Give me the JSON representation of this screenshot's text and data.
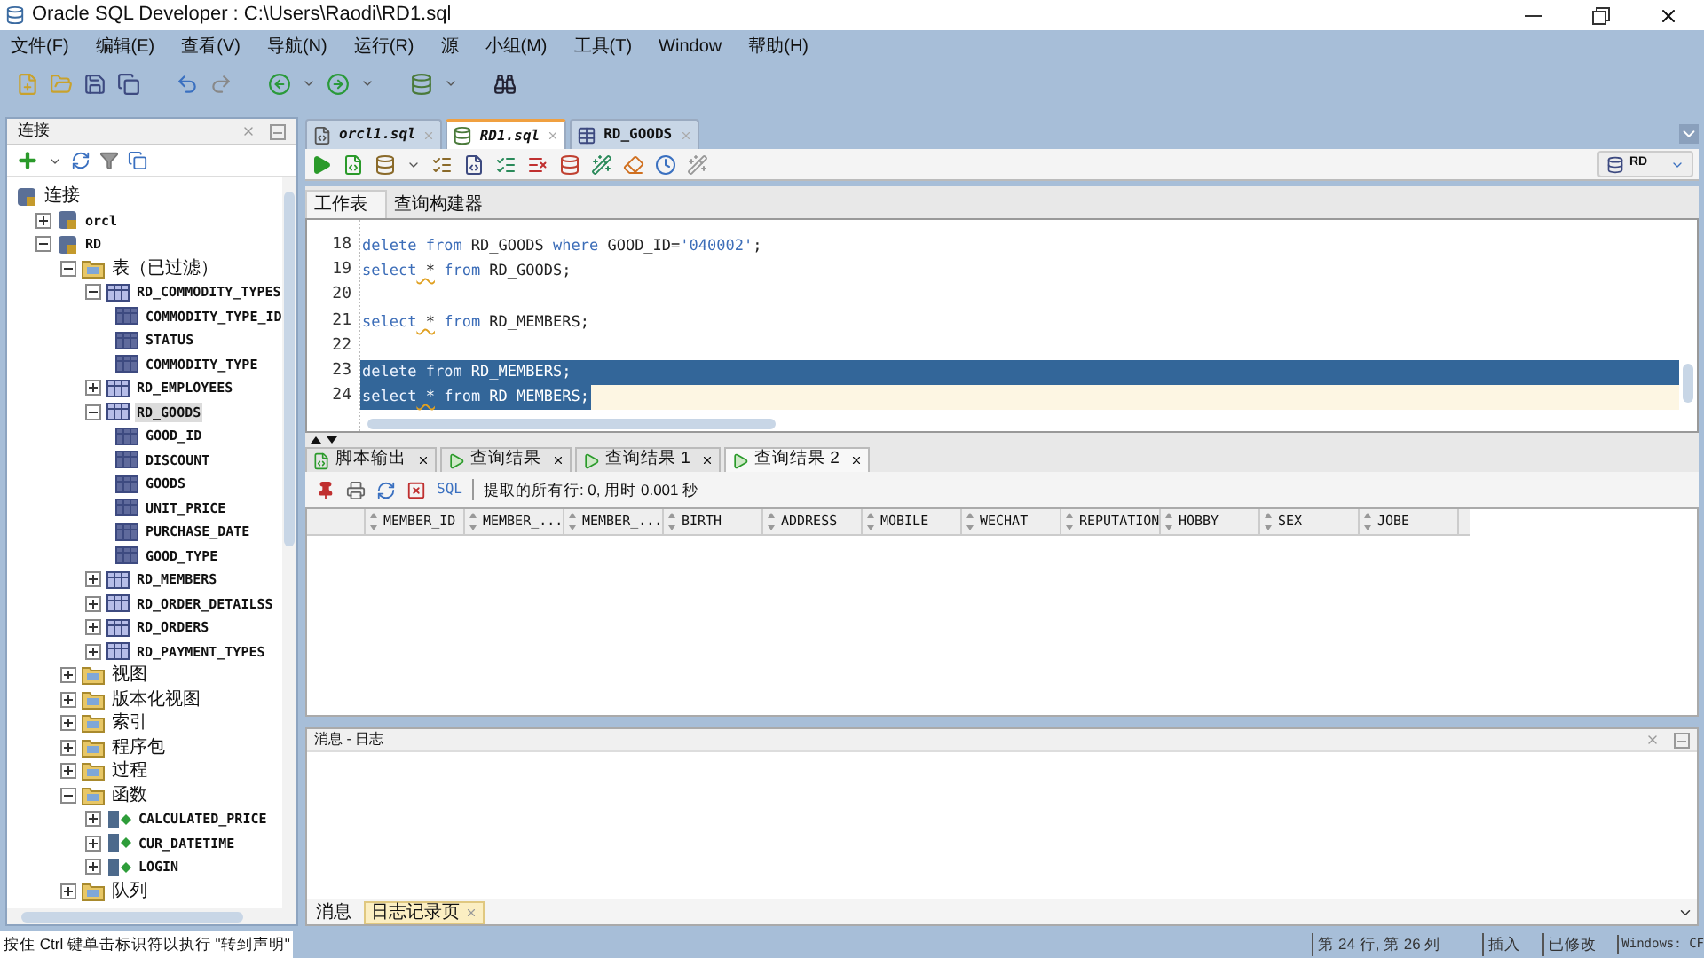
{
  "window": {
    "title": "Oracle SQL Developer : C:\\Users\\Raodi\\RD1.sql"
  },
  "menu": [
    "文件(F)",
    "编辑(E)",
    "查看(V)",
    "导航(N)",
    "运行(R)",
    "源",
    "小组(M)",
    "工具(T)",
    "Window",
    "帮助(H)"
  ],
  "connections_panel": {
    "title": "连接",
    "tree": [
      {
        "label": "连接",
        "kind": "root",
        "selected": false,
        "children": [
          {
            "label": "orcl",
            "kind": "connection",
            "expanded": false,
            "selected": false
          },
          {
            "label": "RD",
            "kind": "connection",
            "expanded": true,
            "selected": false,
            "children": [
              {
                "label": "表（已过滤）",
                "kind": "folder",
                "expanded": true,
                "selected": false,
                "children": [
                  {
                    "label": "RD_COMMODITY_TYPES",
                    "kind": "table",
                    "expanded": true,
                    "selected": false,
                    "children": [
                      {
                        "label": "COMMODITY_TYPE_ID",
                        "kind": "column",
                        "selected": false
                      },
                      {
                        "label": "STATUS",
                        "kind": "column",
                        "selected": false
                      },
                      {
                        "label": "COMMODITY_TYPE",
                        "kind": "column",
                        "selected": false
                      }
                    ]
                  },
                  {
                    "label": "RD_EMPLOYEES",
                    "kind": "table",
                    "expanded": false,
                    "selected": false
                  },
                  {
                    "label": "RD_GOODS",
                    "kind": "table",
                    "expanded": true,
                    "selected": true,
                    "children": [
                      {
                        "label": "GOOD_ID",
                        "kind": "column",
                        "selected": false
                      },
                      {
                        "label": "DISCOUNT",
                        "kind": "column",
                        "selected": false
                      },
                      {
                        "label": "GOODS",
                        "kind": "column",
                        "selected": false
                      },
                      {
                        "label": "UNIT_PRICE",
                        "kind": "column",
                        "selected": false
                      },
                      {
                        "label": "PURCHASE_DATE",
                        "kind": "column",
                        "selected": false
                      },
                      {
                        "label": "GOOD_TYPE",
                        "kind": "column",
                        "selected": false
                      }
                    ]
                  },
                  {
                    "label": "RD_MEMBERS",
                    "kind": "table",
                    "expanded": false,
                    "selected": false
                  },
                  {
                    "label": "RD_ORDER_DETAILSS",
                    "kind": "table",
                    "expanded": false,
                    "selected": false
                  },
                  {
                    "label": "RD_ORDERS",
                    "kind": "table",
                    "expanded": false,
                    "selected": false
                  },
                  {
                    "label": "RD_PAYMENT_TYPES",
                    "kind": "table",
                    "expanded": false,
                    "selected": false
                  }
                ]
              },
              {
                "label": "视图",
                "kind": "folder",
                "expanded": false,
                "selected": false
              },
              {
                "label": "版本化视图",
                "kind": "folder",
                "expanded": false,
                "selected": false
              },
              {
                "label": "索引",
                "kind": "folder",
                "expanded": false,
                "selected": false
              },
              {
                "label": "程序包",
                "kind": "folder",
                "expanded": false,
                "selected": false
              },
              {
                "label": "过程",
                "kind": "folder",
                "expanded": false,
                "selected": false
              },
              {
                "label": "函数",
                "kind": "folder",
                "expanded": true,
                "selected": false,
                "children": [
                  {
                    "label": "CALCULATED_PRICE",
                    "kind": "function",
                    "expanded": false,
                    "selected": false
                  },
                  {
                    "label": "CUR_DATETIME",
                    "kind": "function",
                    "expanded": false,
                    "selected": false
                  },
                  {
                    "label": "LOGIN",
                    "kind": "function",
                    "expanded": false,
                    "selected": false
                  }
                ]
              },
              {
                "label": "队列",
                "kind": "folder",
                "expanded": false,
                "selected": false
              }
            ]
          }
        ]
      }
    ]
  },
  "editor_tabs": [
    {
      "label": "orcl1.sql",
      "kind": "file",
      "selected": false
    },
    {
      "label": "RD1.sql",
      "kind": "worksheet",
      "selected": true
    },
    {
      "label": "RD_GOODS",
      "kind": "table",
      "selected": false
    }
  ],
  "connection_selector": {
    "value": "RD"
  },
  "worksheet_tabs": [
    {
      "label": "工作表",
      "selected": true
    },
    {
      "label": "查询构建器",
      "selected": false
    }
  ],
  "code_lines": [
    {
      "number": "18",
      "selected": false,
      "current": false,
      "tokens": [
        {
          "text": "delete",
          "kind": "keyword"
        },
        {
          "text": " from",
          "kind": "keyword"
        },
        {
          "text": " RD_GOODS ",
          "kind": "plain"
        },
        {
          "text": "where",
          "kind": "keyword"
        },
        {
          "text": " GOOD_ID=",
          "kind": "plain"
        },
        {
          "text": "'040002'",
          "kind": "string"
        },
        {
          "text": ";",
          "kind": "plain"
        }
      ]
    },
    {
      "number": "19",
      "selected": false,
      "current": false,
      "tokens": [
        {
          "text": "select",
          "kind": "keyword"
        },
        {
          "text": " *",
          "kind": "warning"
        },
        {
          "text": " from",
          "kind": "keyword"
        },
        {
          "text": " RD_GOODS;",
          "kind": "plain"
        }
      ]
    },
    {
      "number": "20"
    },
    {
      "number": "21",
      "selected": false,
      "current": false,
      "tokens": [
        {
          "text": "select",
          "kind": "keyword"
        },
        {
          "text": " *",
          "kind": "warning"
        },
        {
          "text": " from",
          "kind": "keyword"
        },
        {
          "text": " RD_MEMBERS;",
          "kind": "plain"
        }
      ]
    },
    {
      "number": "22"
    },
    {
      "number": "23",
      "selected": true,
      "current": false,
      "tokens": [
        {
          "text": "delete",
          "kind": "keyword"
        },
        {
          "text": " from",
          "kind": "keyword"
        },
        {
          "text": " RD_MEMBERS;",
          "kind": "plain"
        }
      ]
    },
    {
      "number": "24",
      "selected": true,
      "current": true,
      "tokens": [
        {
          "text": "select",
          "kind": "keyword"
        },
        {
          "text": " *",
          "kind": "warning"
        },
        {
          "text": " from",
          "kind": "keyword"
        },
        {
          "text": " RD_MEMBERS;",
          "kind": "plain"
        }
      ]
    }
  ],
  "result_tabs": [
    {
      "label": "脚本输出",
      "kind": "output",
      "selected": false
    },
    {
      "label": "查询结果",
      "kind": "result",
      "selected": false
    },
    {
      "label": "查询结果 1",
      "kind": "result",
      "selected": false
    },
    {
      "label": "查询结果 2",
      "kind": "result",
      "selected": true
    }
  ],
  "result_status": {
    "sql_link": "SQL",
    "message": "提取的所有行: 0, 用时 0.001 秒"
  },
  "result_columns": [
    "MEMBER_ID",
    "MEMBER_...",
    "MEMBER_...",
    "BIRTH",
    "ADDRESS",
    "MOBILE",
    "WECHAT",
    "REPUTATION",
    "HOBBY",
    "SEX",
    "JOBE"
  ],
  "log_panel": {
    "title": "消息 - 日志",
    "tabs": [
      {
        "label": "消息",
        "selected": false
      },
      {
        "label": "日志记录页",
        "selected": true
      }
    ]
  },
  "status_bar": {
    "hint": "按住 Ctrl 键单击标识符以执行 \"转到声明\"",
    "position": "第 24 行, 第 26 列",
    "mode": "插入",
    "modified": "已修改",
    "encoding": "Windows: CF"
  }
}
